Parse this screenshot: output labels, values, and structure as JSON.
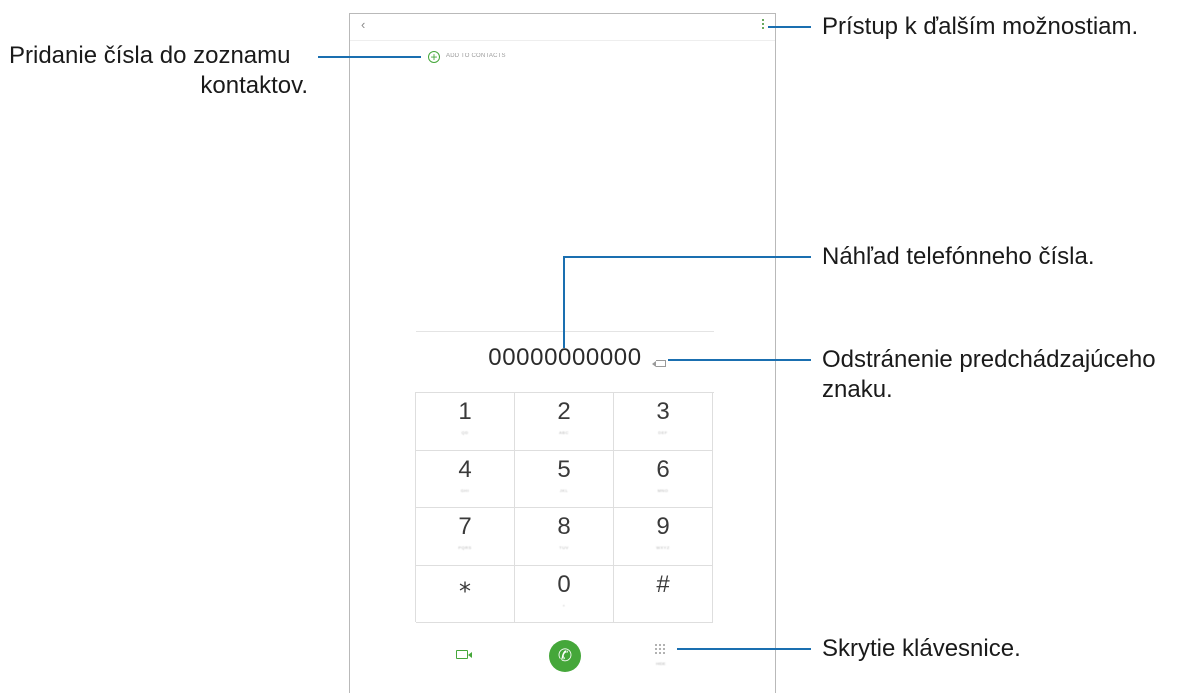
{
  "screen": {
    "add_to_contacts": "ADD TO CONTACTS",
    "phone_number": "00000000000",
    "keys": [
      {
        "digit": "1",
        "letters": "QD"
      },
      {
        "digit": "2",
        "letters": "ABC"
      },
      {
        "digit": "3",
        "letters": "DEF"
      },
      {
        "digit": "4",
        "letters": "GHI"
      },
      {
        "digit": "5",
        "letters": "JKL"
      },
      {
        "digit": "6",
        "letters": "MNO"
      },
      {
        "digit": "7",
        "letters": "PQRS"
      },
      {
        "digit": "8",
        "letters": "TUV"
      },
      {
        "digit": "9",
        "letters": "WXYZ"
      },
      {
        "digit": "⁎",
        "letters": ""
      },
      {
        "digit": "0",
        "letters": "+"
      },
      {
        "digit": "#",
        "letters": ""
      }
    ],
    "hide_label": "HIDE"
  },
  "callouts": {
    "add_number": [
      "Pridanie čísla do zoznamu",
      "kontaktov."
    ],
    "more_options": "Prístup k ďalším možnostiam.",
    "preview": "Náhľad telefónneho čísla.",
    "delete_char": [
      "Odstránenie predchádzajúceho",
      "znaku."
    ],
    "hide_keypad": "Skrytie klávesnice."
  },
  "colors": {
    "accent": "#45a73a",
    "callout_line": "#1a6fb0"
  }
}
